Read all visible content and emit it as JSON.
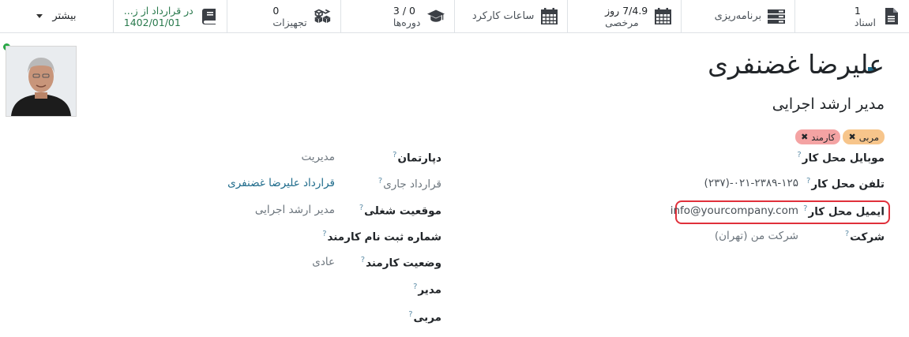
{
  "smart_buttons": {
    "documents": {
      "value": "1",
      "label": "اسناد",
      "icon": "document-icon"
    },
    "planning": {
      "label": "برنامه‌ریزی",
      "icon": "planning-icon"
    },
    "time_off": {
      "value": "7/4.9 روز",
      "label": "مرخصی",
      "icon": "calendar-icon"
    },
    "timesheets": {
      "label": "ساعات کارکرد",
      "icon": "calendar-icon"
    },
    "courses": {
      "value": "0 / 3",
      "label": "دوره‌ها",
      "icon": "graduation-cap-icon"
    },
    "equipment": {
      "value": "0",
      "label": "تجهیزات",
      "icon": "cubes-icon"
    },
    "contract": {
      "value": "در قرارداد از ز...",
      "label": "1402/01/01",
      "icon": "book-icon",
      "color": "#28794c"
    },
    "more": {
      "label": "بیشتر"
    }
  },
  "employee": {
    "name": "علیرضا غضنفری",
    "job_title": "مدیر ارشد اجرایی",
    "online_status_color": "#28a745",
    "tags": [
      {
        "label": "کارمند",
        "color": "#f4a3a3"
      },
      {
        "label": "مربی",
        "color": "#f7c58b"
      }
    ]
  },
  "left_fields": {
    "work_mobile": {
      "label": "موبایل محل کار",
      "value": ""
    },
    "work_phone": {
      "label": "تلفن محل کار",
      "value": "۰۲۱-۲۳۸۹-۱۲۵-(۲۳۷)"
    },
    "work_email": {
      "label": "ایمیل محل کار",
      "value": "info@yourcompany.com"
    },
    "company": {
      "label": "شرکت",
      "value": "شرکت من (تهران)"
    }
  },
  "right_fields": {
    "department": {
      "label": "دپارتمان",
      "value": "مدیریت"
    },
    "current_contract": {
      "label": "قرارداد جاری",
      "value": "قرارداد علیرضا غضنفری"
    },
    "job_position": {
      "label": "موقعیت شغلی",
      "value": "مدیر ارشد اجرایی"
    },
    "registration_number": {
      "label": "شماره ثبت نام کارمند",
      "value": ""
    },
    "employee_type": {
      "label": "وضعیت کارمند",
      "value": "عادی"
    },
    "manager": {
      "label": "مدیر",
      "value": ""
    },
    "coach": {
      "label": "مربی",
      "value": ""
    }
  },
  "colors": {
    "highlight_border": "#e0303b",
    "link": "#1d6a8a",
    "help_icon": "#5f8ea8"
  }
}
